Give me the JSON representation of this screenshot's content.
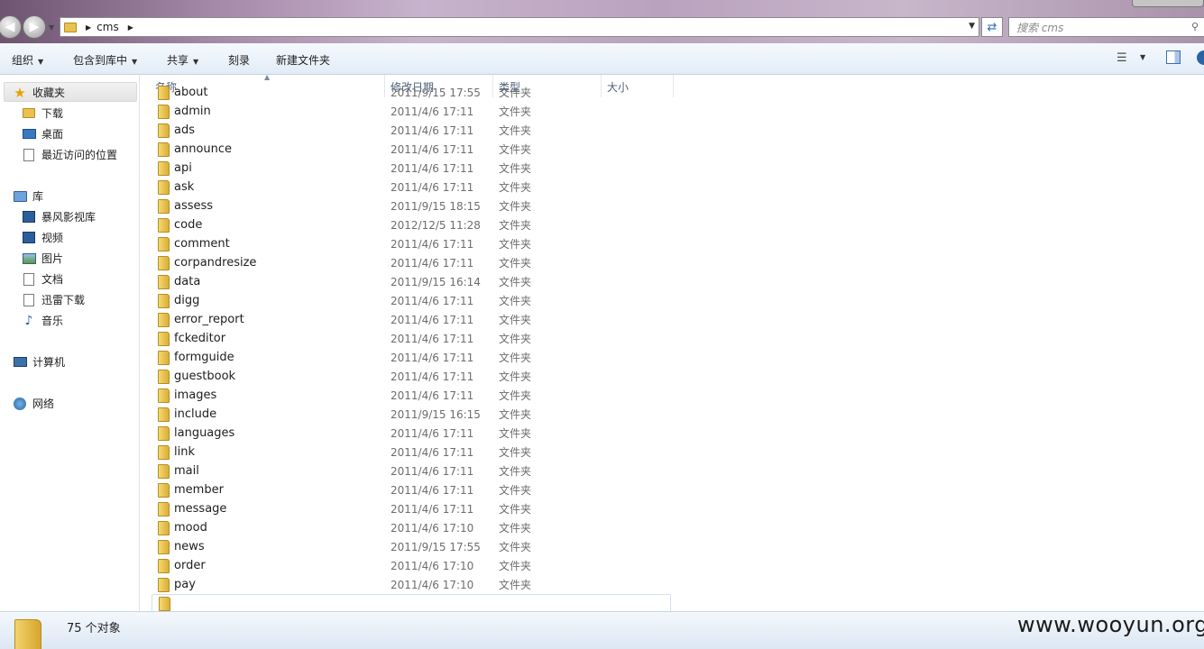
{
  "address_bar": {
    "crumbs": [
      "cms"
    ],
    "search_placeholder": "搜索 cms"
  },
  "toolbar": {
    "organize": "组织",
    "include_in_library": "包含到库中",
    "share": "共享",
    "burn": "刻录",
    "new_folder": "新建文件夹"
  },
  "nav": {
    "favorites": "收藏夹",
    "downloads": "下载",
    "desktop": "桌面",
    "recent": "最近访问的位置",
    "libraries": "库",
    "baofeng": "暴风影视库",
    "videos": "视频",
    "pictures": "图片",
    "documents": "文档",
    "xunlei": "迅雷下载",
    "music": "音乐",
    "computer": "计算机",
    "network": "网络"
  },
  "columns": {
    "name": "名称",
    "modified": "修改日期",
    "type": "类型",
    "size": "大小"
  },
  "files": [
    {
      "name": "about",
      "date": "2011/9/15 17:55",
      "type": "文件夹"
    },
    {
      "name": "admin",
      "date": "2011/4/6 17:11",
      "type": "文件夹"
    },
    {
      "name": "ads",
      "date": "2011/4/6 17:11",
      "type": "文件夹"
    },
    {
      "name": "announce",
      "date": "2011/4/6 17:11",
      "type": "文件夹"
    },
    {
      "name": "api",
      "date": "2011/4/6 17:11",
      "type": "文件夹"
    },
    {
      "name": "ask",
      "date": "2011/4/6 17:11",
      "type": "文件夹"
    },
    {
      "name": "assess",
      "date": "2011/9/15 18:15",
      "type": "文件夹"
    },
    {
      "name": "code",
      "date": "2012/12/5 11:28",
      "type": "文件夹"
    },
    {
      "name": "comment",
      "date": "2011/4/6 17:11",
      "type": "文件夹"
    },
    {
      "name": "corpandresize",
      "date": "2011/4/6 17:11",
      "type": "文件夹"
    },
    {
      "name": "data",
      "date": "2011/9/15 16:14",
      "type": "文件夹"
    },
    {
      "name": "digg",
      "date": "2011/4/6 17:11",
      "type": "文件夹"
    },
    {
      "name": "error_report",
      "date": "2011/4/6 17:11",
      "type": "文件夹"
    },
    {
      "name": "fckeditor",
      "date": "2011/4/6 17:11",
      "type": "文件夹"
    },
    {
      "name": "formguide",
      "date": "2011/4/6 17:11",
      "type": "文件夹"
    },
    {
      "name": "guestbook",
      "date": "2011/4/6 17:11",
      "type": "文件夹"
    },
    {
      "name": "images",
      "date": "2011/4/6 17:11",
      "type": "文件夹"
    },
    {
      "name": "include",
      "date": "2011/9/15 16:15",
      "type": "文件夹"
    },
    {
      "name": "languages",
      "date": "2011/4/6 17:11",
      "type": "文件夹"
    },
    {
      "name": "link",
      "date": "2011/4/6 17:11",
      "type": "文件夹"
    },
    {
      "name": "mail",
      "date": "2011/4/6 17:11",
      "type": "文件夹"
    },
    {
      "name": "member",
      "date": "2011/4/6 17:11",
      "type": "文件夹"
    },
    {
      "name": "message",
      "date": "2011/4/6 17:11",
      "type": "文件夹"
    },
    {
      "name": "mood",
      "date": "2011/4/6 17:10",
      "type": "文件夹"
    },
    {
      "name": "news",
      "date": "2011/9/15 17:55",
      "type": "文件夹"
    },
    {
      "name": "order",
      "date": "2011/4/6 17:10",
      "type": "文件夹"
    },
    {
      "name": "pay",
      "date": "2011/4/6 17:10",
      "type": "文件夹"
    }
  ],
  "status": {
    "count": "75 个对象"
  },
  "watermark": "www.wooyun.org",
  "colors": {
    "titlebar_accent": "#b9a2bd",
    "toolbar_bg": "#e2ecf7",
    "folder": "#e8c14e",
    "header_text": "#4c607a"
  }
}
